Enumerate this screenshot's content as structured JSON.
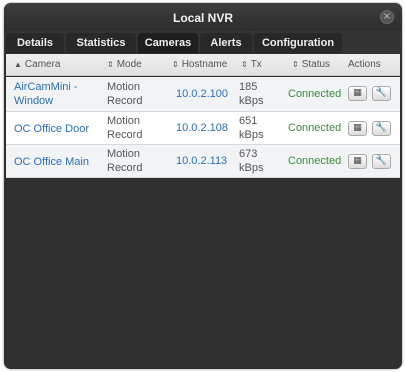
{
  "window": {
    "title": "Local NVR",
    "close_icon": "×"
  },
  "tabs": [
    {
      "label": "Details",
      "active": false
    },
    {
      "label": "Statistics",
      "active": false
    },
    {
      "label": "Cameras",
      "active": true
    },
    {
      "label": "Alerts",
      "active": false
    },
    {
      "label": "Configuration",
      "active": false
    }
  ],
  "table": {
    "columns": [
      {
        "label": "Camera",
        "sort_icon": "▲"
      },
      {
        "label": "Mode",
        "sort_icon": "⇕"
      },
      {
        "label": "Hostname",
        "sort_icon": "⇕"
      },
      {
        "label": "Tx",
        "sort_icon": "⇕"
      },
      {
        "label": "Status",
        "sort_icon": "⇕"
      },
      {
        "label": "Actions",
        "sort_icon": ""
      }
    ],
    "rows": [
      {
        "camera_line1": "AirCamMini -",
        "camera_line2": "Window",
        "mode_line1": "Motion",
        "mode_line2": "Record",
        "hostname": "10.0.2.100",
        "tx_value": "185",
        "tx_unit": "kBps",
        "status": "Connected"
      },
      {
        "camera_line1": "OC Office Door",
        "camera_line2": "",
        "mode_line1": "Motion",
        "mode_line2": "Record",
        "hostname": "10.0.2.108",
        "tx_value": "651",
        "tx_unit": "kBps",
        "status": "Connected"
      },
      {
        "camera_line1": "OC Office Main",
        "camera_line2": "",
        "mode_line1": "Motion",
        "mode_line2": "Record",
        "hostname": "10.0.2.113",
        "tx_value": "673",
        "tx_unit": "kBps",
        "status": "Connected"
      }
    ],
    "action_icons": {
      "view": "▦",
      "settings": "🔧"
    }
  },
  "colors": {
    "link": "#2b6fb8",
    "status_ok": "#3a8c3a",
    "background": "#333333"
  }
}
